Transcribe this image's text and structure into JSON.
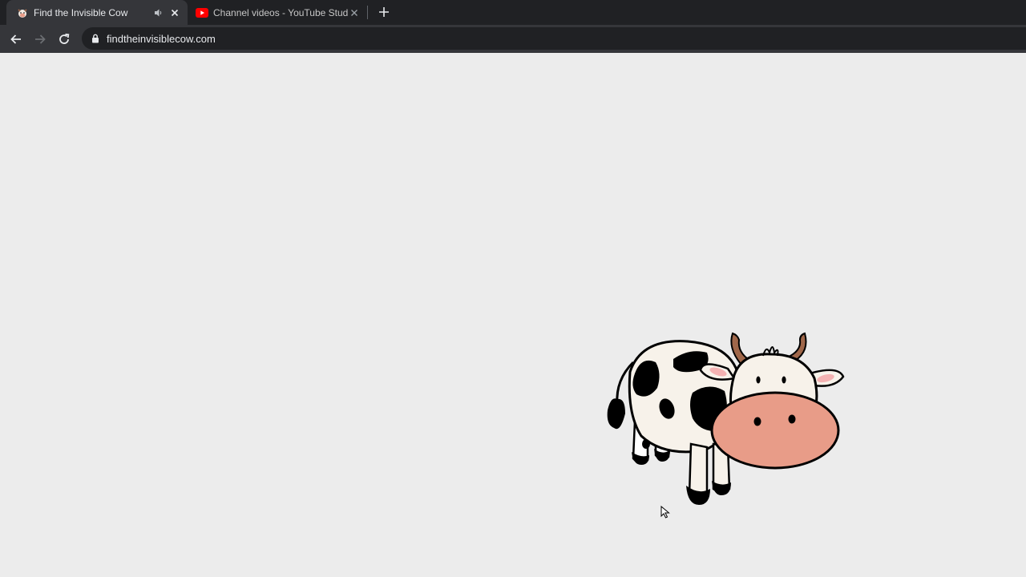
{
  "browser": {
    "tabs": [
      {
        "title": "Find the Invisible Cow",
        "favicon": "cow-favicon",
        "audio": "speaker-icon",
        "active": true
      },
      {
        "title": "Channel videos - YouTube Studio",
        "favicon": "youtube-favicon",
        "active": false
      }
    ],
    "url": "findtheinvisiblecow.com"
  },
  "page": {
    "image": "cartoon-cow",
    "background": "#ececec"
  },
  "colors": {
    "chrome_dark": "#202124",
    "chrome_toolbar": "#35363a",
    "cow_nose": "#e89c88",
    "cow_horn": "#a0674a"
  }
}
